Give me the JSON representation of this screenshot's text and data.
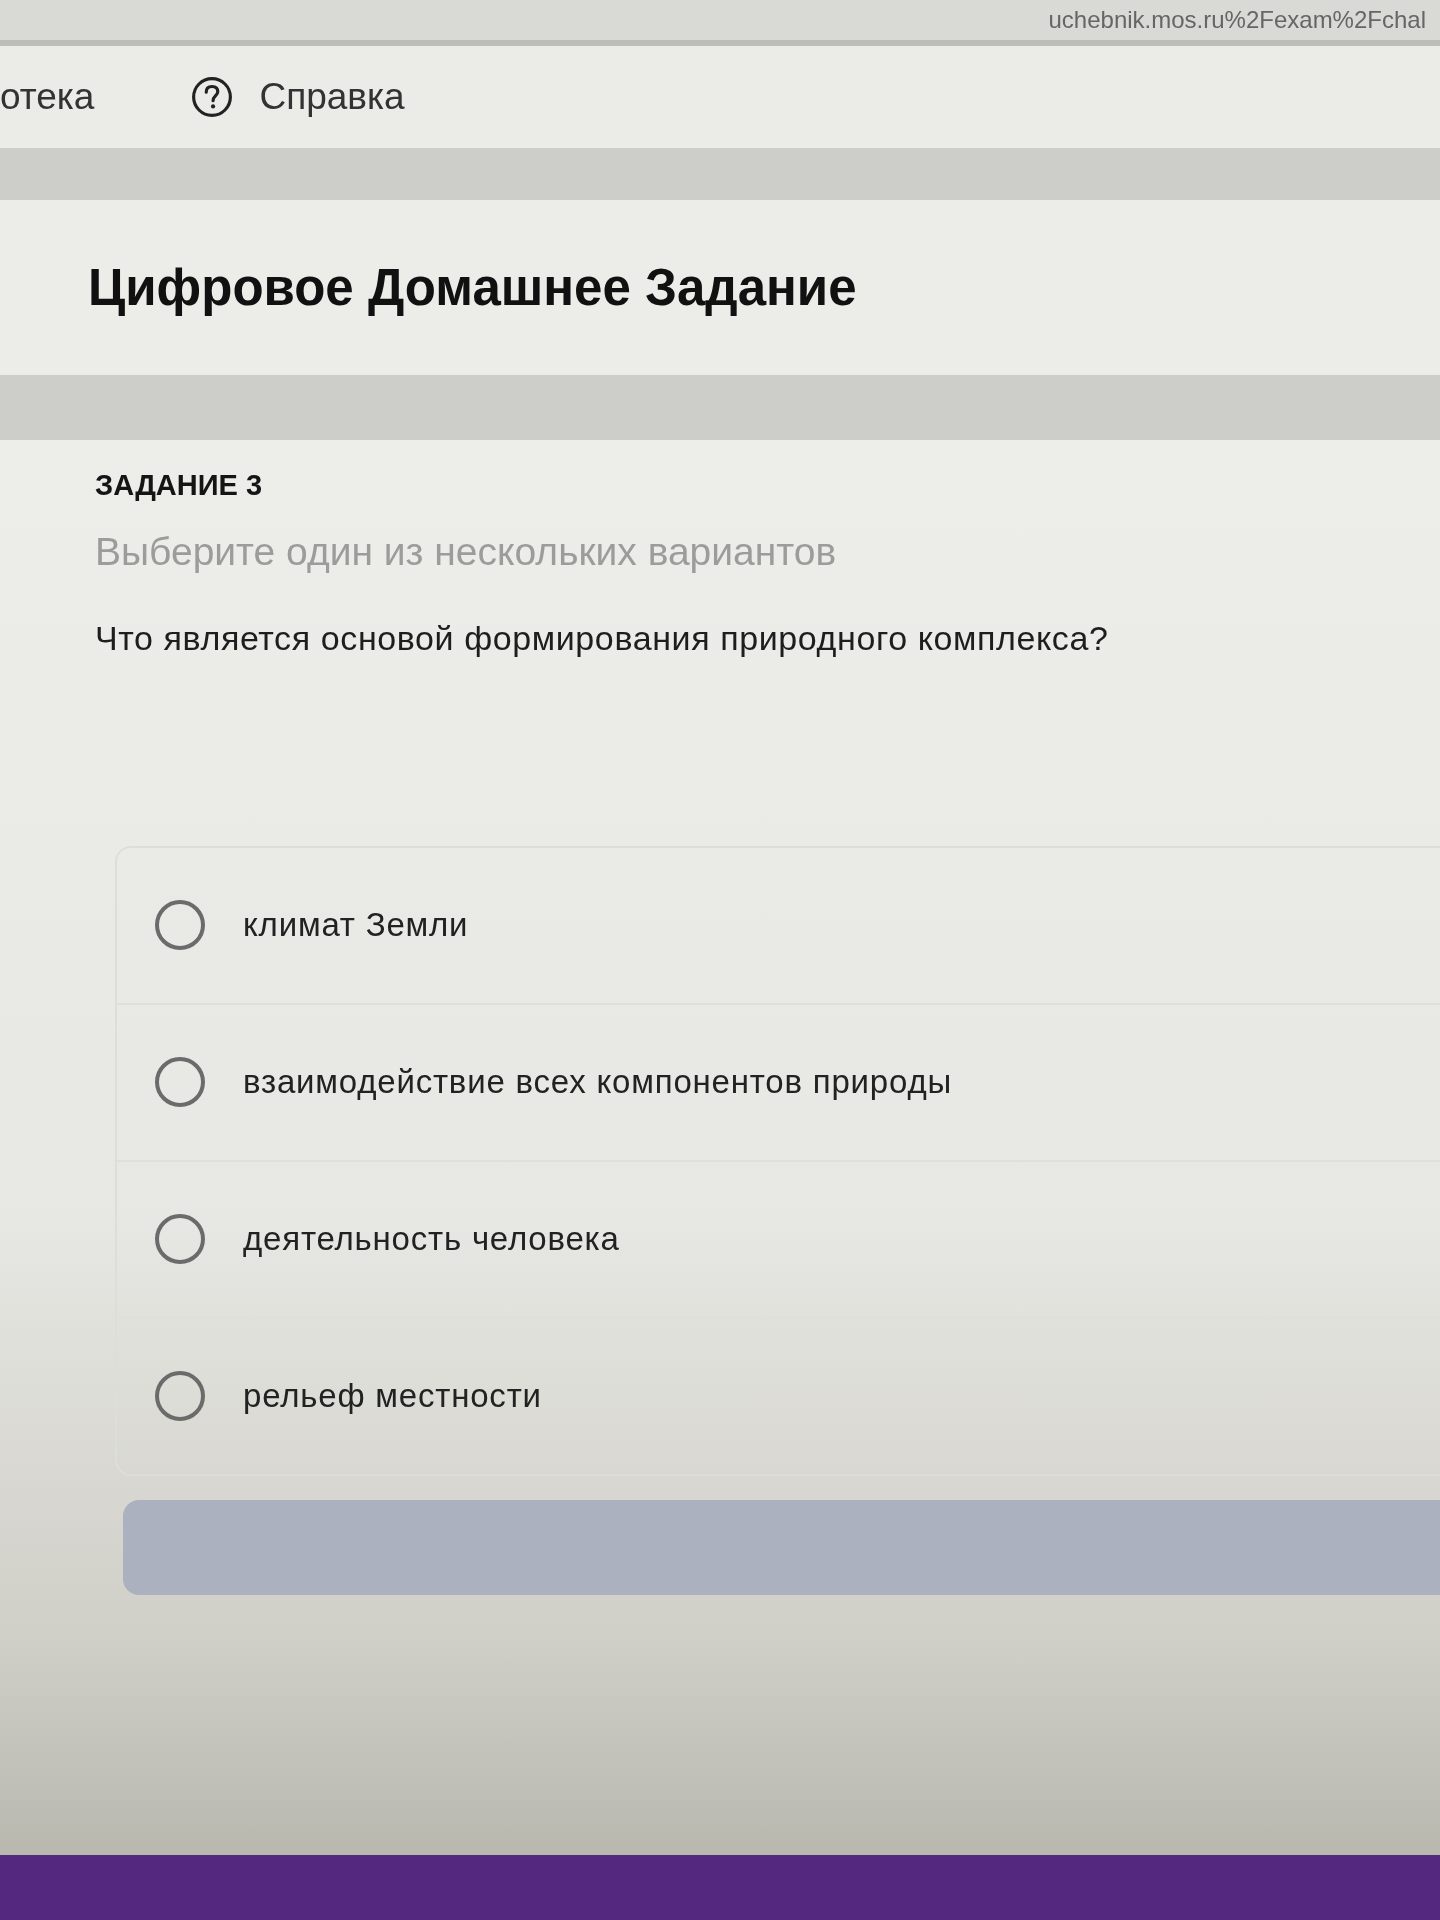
{
  "address_bar": {
    "url": "uchebnik.mos.ru%2Fexam%2Fchal"
  },
  "nav": {
    "items": [
      {
        "label": "отека",
        "kind": "link"
      },
      {
        "label": "Справка",
        "kind": "help"
      }
    ]
  },
  "header": {
    "title": "Цифровое Домашнее Задание"
  },
  "task": {
    "number": "ЗАДАНИЕ 3",
    "instruction": "Выберите один из нескольких вариантов",
    "question": "Что является основой формирования природного комплекса?",
    "options": [
      {
        "label": "климат Земли",
        "selected": false
      },
      {
        "label": "взаимодействие всех компонентов природы",
        "selected": false
      },
      {
        "label": "деятельность человека",
        "selected": false
      },
      {
        "label": "рельеф местности",
        "selected": false
      }
    ],
    "submit_button": {
      "disabled": true
    }
  }
}
